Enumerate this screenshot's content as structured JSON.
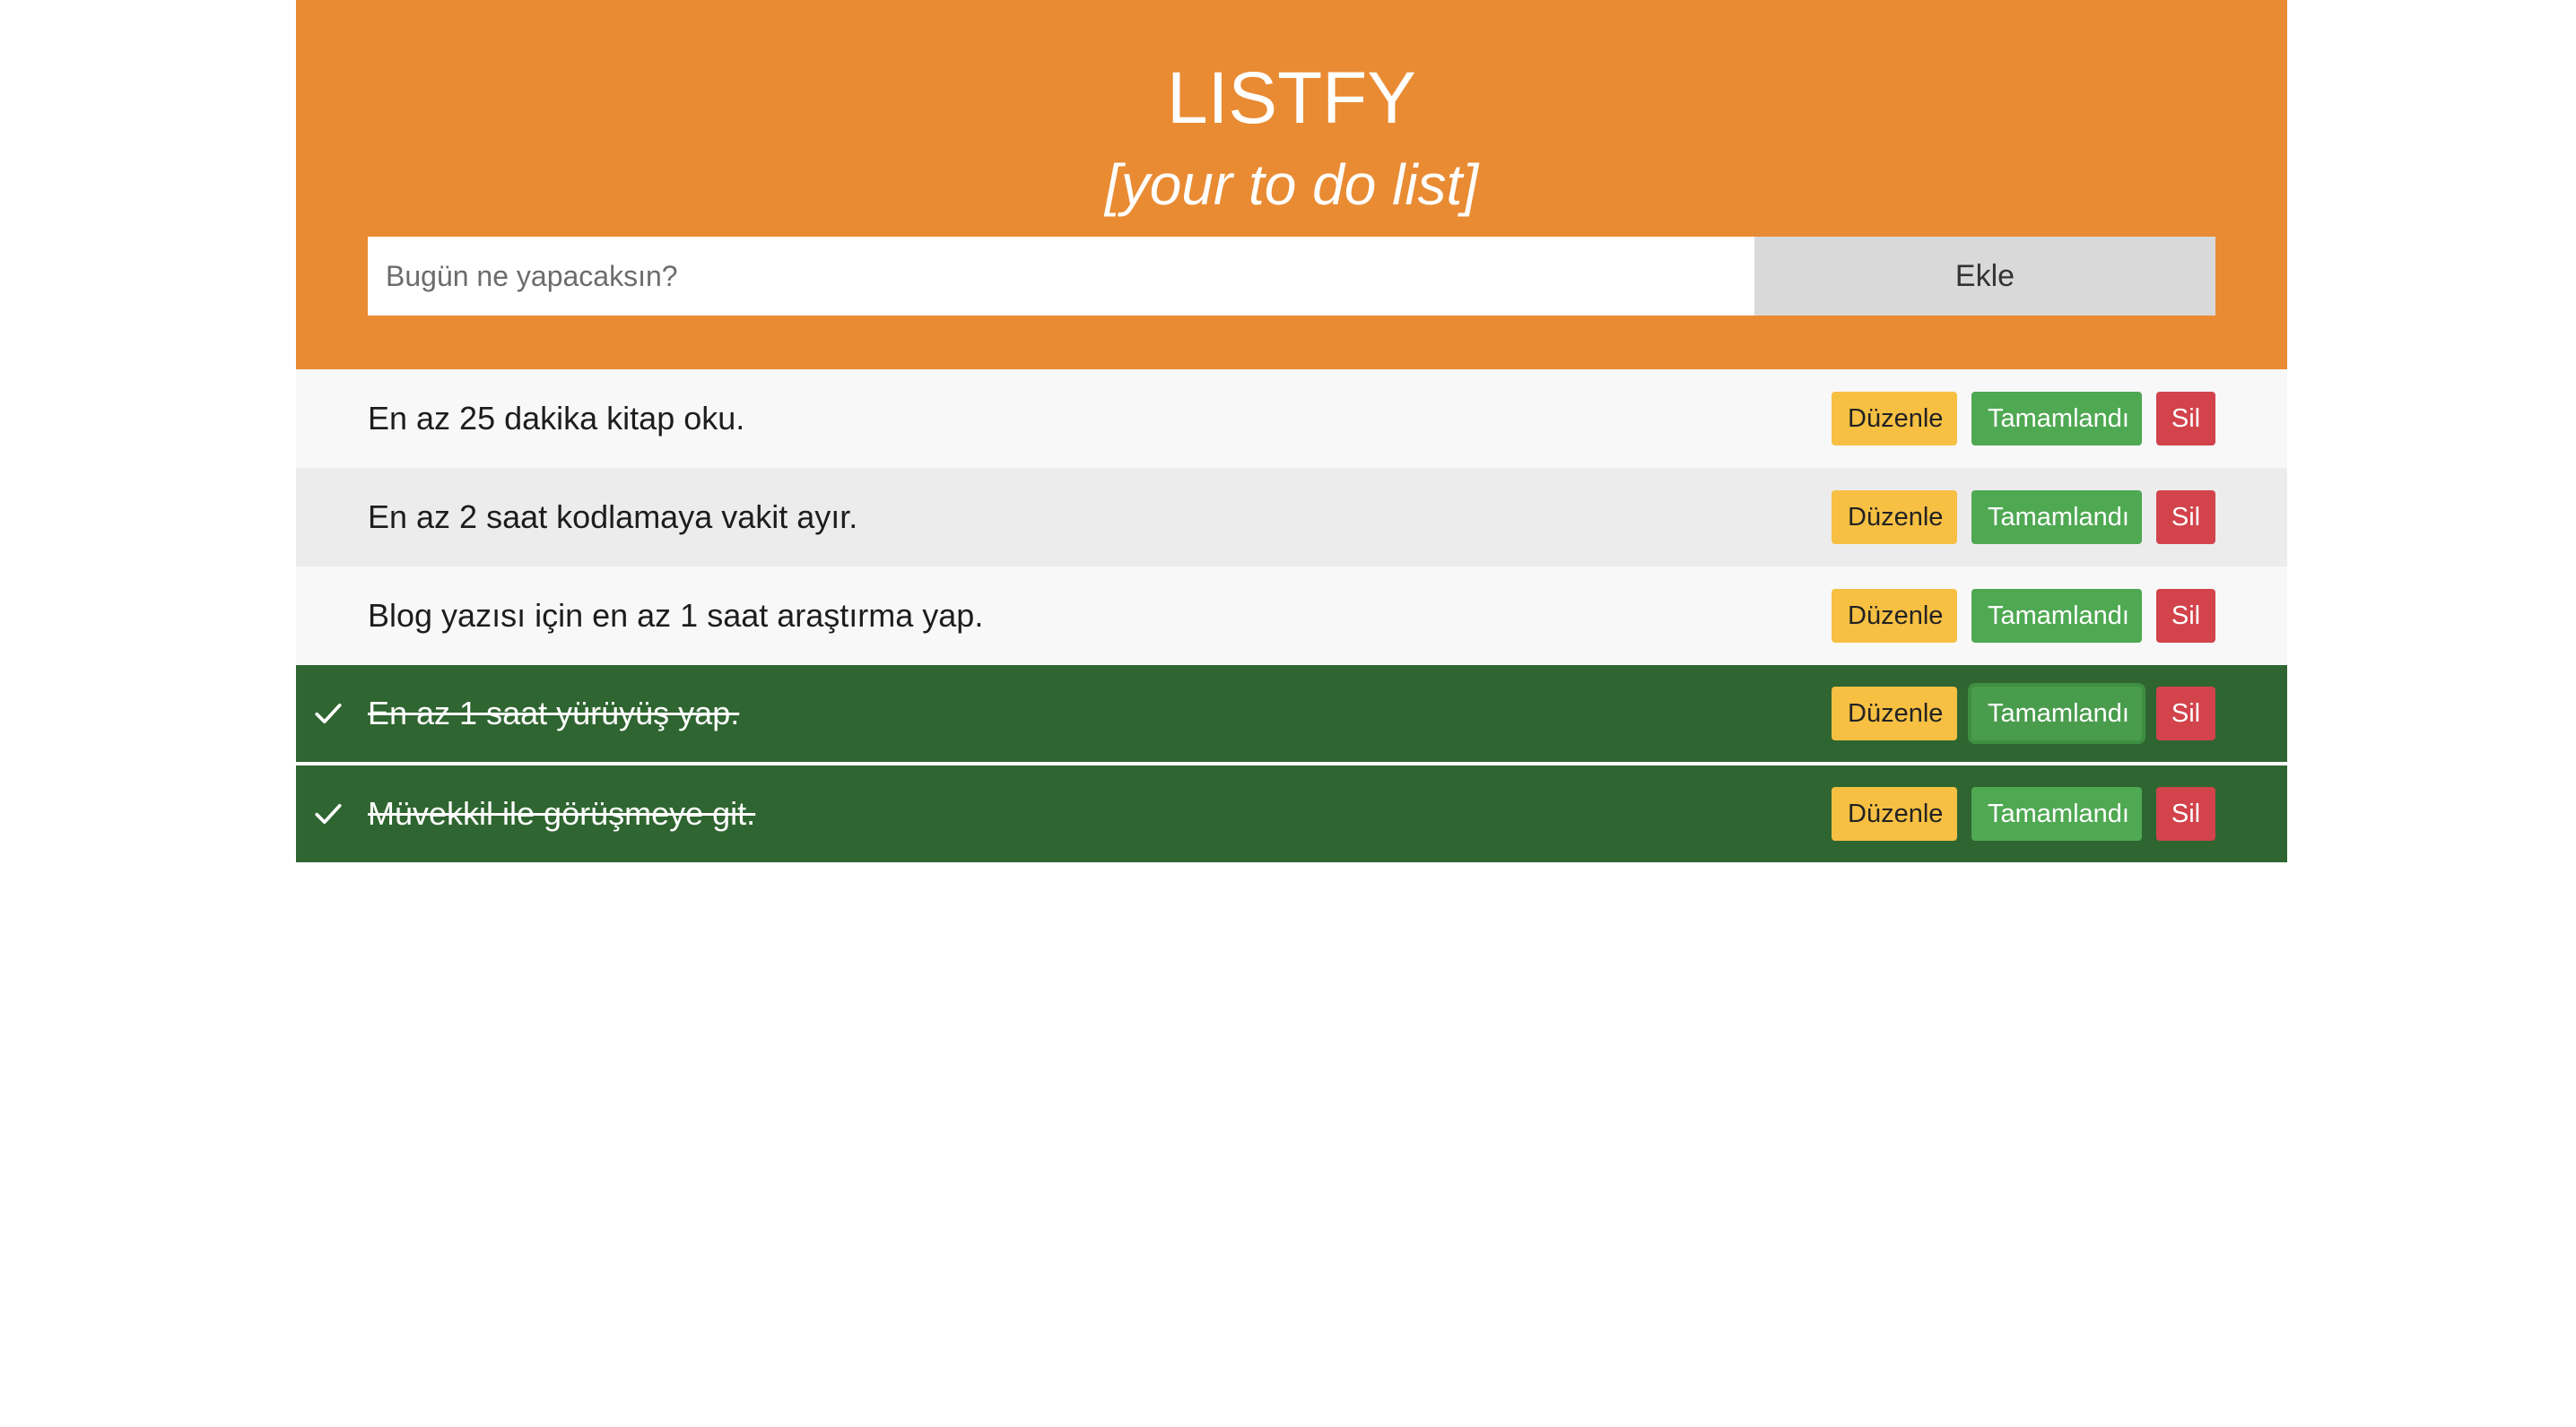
{
  "app": {
    "title": "LISTFY",
    "subtitle": "[your to do list]"
  },
  "add_form": {
    "placeholder": "Bugün ne yapacaksın?",
    "value": "",
    "add_label": "Ekle"
  },
  "colors": {
    "header_bg": "#e98b33",
    "done_bg": "#2f6530",
    "edit_btn": "#f7c043",
    "complete_btn": "#4fa852",
    "delete_btn": "#d2434b"
  },
  "actions": {
    "edit_label": "Düzenle",
    "complete_label": "Tamamlandı",
    "delete_label": "Sil"
  },
  "tasks": [
    {
      "text": "En az 25 dakika kitap oku.",
      "done": false
    },
    {
      "text": "En az 2 saat kodlamaya vakit ayır.",
      "done": false
    },
    {
      "text": "Blog yazısı için en az 1 saat araştırma yap.",
      "done": false
    },
    {
      "text": "En az 1 saat yürüyüş yap.",
      "done": true,
      "icon": "checkmark-icon"
    },
    {
      "text": "Müvekkil ile görüşmeye git.",
      "done": true,
      "icon": "checkmark-icon"
    }
  ]
}
